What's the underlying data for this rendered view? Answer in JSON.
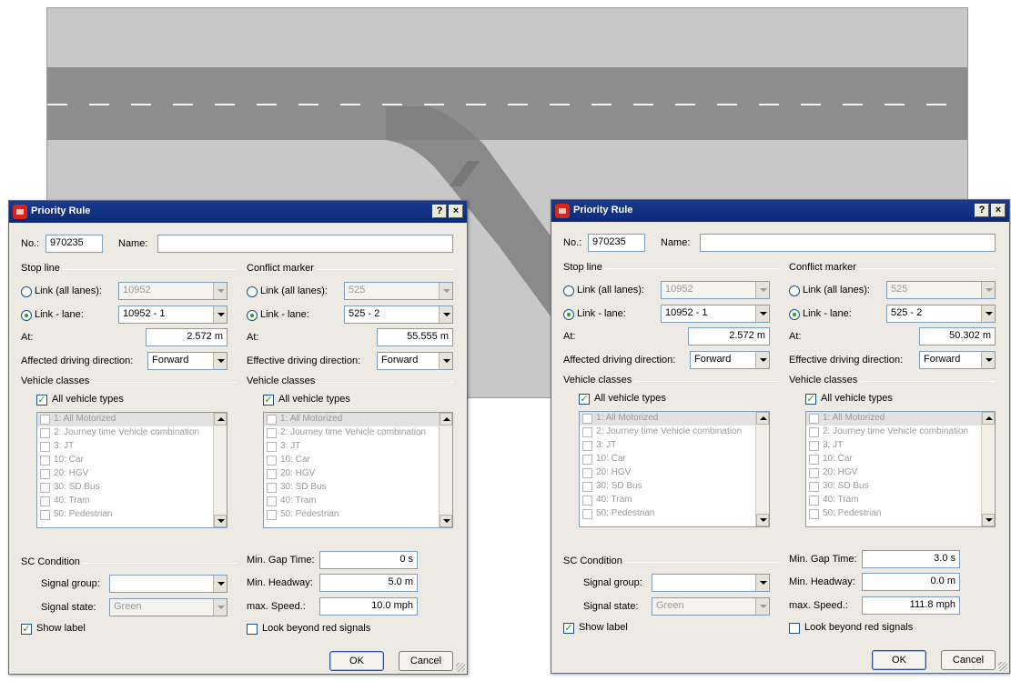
{
  "scene": {
    "road_color": "#8e8e8e",
    "background_color": "#c8c8c8"
  },
  "dialogs": [
    {
      "title": "Priority Rule",
      "help_glyph": "?",
      "close_glyph": "×",
      "no_label": "No.:",
      "no_value": "970235",
      "name_label": "Name:",
      "name_value": "",
      "stop_line": {
        "title": "Stop line",
        "link_all_label": "Link (all lanes):",
        "link_all_value": "10952",
        "link_lane_label": "Link - lane:",
        "link_lane_value": "10952 - 1",
        "at_label": "At:",
        "at_value": "2.572 m",
        "direction_label": "Affected driving direction:",
        "direction_value": "Forward"
      },
      "conflict_marker": {
        "title": "Conflict marker",
        "link_all_label": "Link (all lanes):",
        "link_all_value": "525",
        "link_lane_label": "Link - lane:",
        "link_lane_value": "525 - 2",
        "at_label": "At:",
        "at_value": "55.555 m",
        "direction_label": "Effective driving direction:",
        "direction_value": "Forward"
      },
      "vehicle_classes_label": "Vehicle classes",
      "all_vehicle_types_label": "All vehicle types",
      "vehicle_items": [
        "1: All Motorized",
        "2: Journey time Vehicle combination",
        "3: JT",
        "10: Car",
        "20: HGV",
        "30: SD Bus",
        "40: Tram",
        "50: Pedestrian"
      ],
      "sc_condition": {
        "title": "SC Condition",
        "signal_group_label": "Signal group:",
        "signal_group_value": "",
        "signal_state_label": "Signal state:",
        "signal_state_value": "Green"
      },
      "min_gap_label": "Min. Gap Time:",
      "min_gap_value": "0 s",
      "min_headway_label": "Min. Headway:",
      "min_headway_value": "5.0 m",
      "max_speed_label": "max. Speed.:",
      "max_speed_value": "10.0 mph",
      "show_label_label": "Show label",
      "look_beyond_label": "Look beyond red signals",
      "ok_label": "OK",
      "cancel_label": "Cancel"
    },
    {
      "title": "Priority Rule",
      "help_glyph": "?",
      "close_glyph": "×",
      "no_label": "No.:",
      "no_value": "970235",
      "name_label": "Name:",
      "name_value": "",
      "stop_line": {
        "title": "Stop line",
        "link_all_label": "Link (all lanes):",
        "link_all_value": "10952",
        "link_lane_label": "Link - lane:",
        "link_lane_value": "10952 - 1",
        "at_label": "At:",
        "at_value": "2.572 m",
        "direction_label": "Affected driving direction:",
        "direction_value": "Forward"
      },
      "conflict_marker": {
        "title": "Conflict marker",
        "link_all_label": "Link (all lanes):",
        "link_all_value": "525",
        "link_lane_label": "Link - lane:",
        "link_lane_value": "525 - 2",
        "at_label": "At:",
        "at_value": "50.302 m",
        "direction_label": "Effective driving direction:",
        "direction_value": "Forward"
      },
      "vehicle_classes_label": "Vehicle classes",
      "all_vehicle_types_label": "All vehicle types",
      "vehicle_items": [
        "1: All Motorized",
        "2: Journey time Vehicle combination",
        "3: JT",
        "10: Car",
        "20: HGV",
        "30: SD Bus",
        "40: Tram",
        "50: Pedestrian"
      ],
      "sc_condition": {
        "title": "SC Condition",
        "signal_group_label": "Signal group:",
        "signal_group_value": "",
        "signal_state_label": "Signal state:",
        "signal_state_value": "Green"
      },
      "min_gap_label": "Min. Gap Time:",
      "min_gap_value": "3.0 s",
      "min_headway_label": "Min. Headway:",
      "min_headway_value": "0.0 m",
      "max_speed_label": "max. Speed.:",
      "max_speed_value": "111.8 mph",
      "show_label_label": "Show label",
      "look_beyond_label": "Look beyond red signals",
      "ok_label": "OK",
      "cancel_label": "Cancel"
    }
  ]
}
